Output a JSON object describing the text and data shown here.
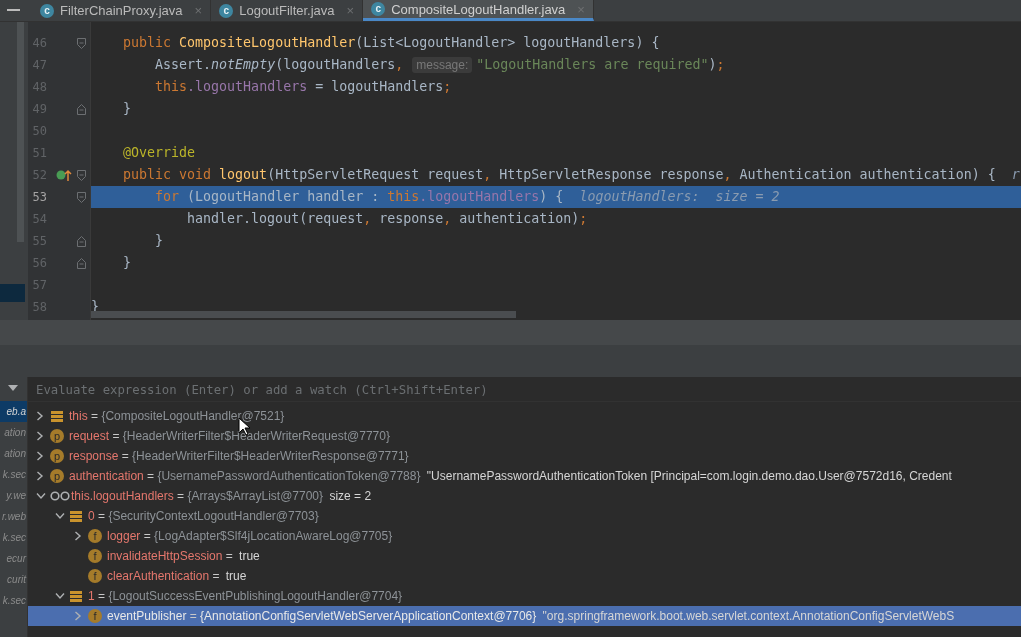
{
  "tabs": [
    {
      "label": "FilterChainProxy.java",
      "icon_letter": "c",
      "close": "×",
      "selected": false
    },
    {
      "label": "LogoutFilter.java",
      "icon_letter": "c",
      "close": "×",
      "selected": false
    },
    {
      "label": "CompositeLogoutHandler.java",
      "icon_letter": "c",
      "close": "×",
      "selected": true
    }
  ],
  "editor": {
    "lines": [
      {
        "number": "46",
        "fold_start": true,
        "fold_end": false,
        "override_marker": false,
        "current": false,
        "tokens": [
          {
            "kind": "keyword",
            "text": "    public "
          },
          {
            "kind": "function",
            "text": "CompositeLogoutHandler"
          },
          {
            "kind": "plain",
            "text": "(List<LogoutHandler> logoutHandlers) {"
          }
        ]
      },
      {
        "number": "47",
        "fold_start": false,
        "fold_end": false,
        "override_marker": false,
        "current": false,
        "tokens": [
          {
            "kind": "plain",
            "text": "        Assert."
          },
          {
            "kind": "static",
            "text": "notEmpty"
          },
          {
            "kind": "plain",
            "text": "(logoutHandlers"
          },
          {
            "kind": "keyword",
            "text": ","
          },
          {
            "kind": "hint",
            "text": "message:"
          },
          {
            "kind": "string",
            "text": "\"LogoutHandlers are required\""
          },
          {
            "kind": "plain",
            "text": ")"
          },
          {
            "kind": "keyword",
            "text": ";"
          }
        ]
      },
      {
        "number": "48",
        "fold_start": false,
        "fold_end": false,
        "override_marker": false,
        "current": false,
        "tokens": [
          {
            "kind": "keyword",
            "text": "        this"
          },
          {
            "kind": "field",
            "text": ".logoutHandlers"
          },
          {
            "kind": "plain",
            "text": " = logoutHandlers"
          },
          {
            "kind": "keyword",
            "text": ";"
          }
        ]
      },
      {
        "number": "49",
        "fold_start": false,
        "fold_end": true,
        "override_marker": false,
        "current": false,
        "tokens": [
          {
            "kind": "plain",
            "text": "    }"
          }
        ]
      },
      {
        "number": "50",
        "fold_start": false,
        "fold_end": false,
        "override_marker": false,
        "current": false
      },
      {
        "number": "51",
        "fold_start": false,
        "fold_end": false,
        "override_marker": false,
        "current": false,
        "tokens": [
          {
            "kind": "annotation",
            "text": "    @Override"
          }
        ]
      },
      {
        "number": "52",
        "fold_start": true,
        "fold_end": false,
        "override_marker": true,
        "current": false,
        "tokens": [
          {
            "kind": "keyword",
            "text": "    public void "
          },
          {
            "kind": "function",
            "text": "logout"
          },
          {
            "kind": "plain",
            "text": "(HttpServletRequest request"
          },
          {
            "kind": "keyword",
            "text": ", "
          },
          {
            "kind": "plain",
            "text": "HttpServletResponse response"
          },
          {
            "kind": "keyword",
            "text": ", "
          },
          {
            "kind": "plain",
            "text": "Authentication authentication) {"
          },
          {
            "kind": "inline",
            "text": "r"
          }
        ]
      },
      {
        "number": "53",
        "fold_start": true,
        "fold_end": false,
        "override_marker": false,
        "current": true,
        "tokens": [
          {
            "kind": "keyword",
            "text": "        for "
          },
          {
            "kind": "plain",
            "text": "(LogoutHandler handler : "
          },
          {
            "kind": "keyword",
            "text": "this"
          },
          {
            "kind": "field",
            "text": ".logoutHandlers"
          },
          {
            "kind": "plain",
            "text": ") {"
          },
          {
            "kind": "inline",
            "text": "logoutHandlers:  size = 2"
          }
        ]
      },
      {
        "number": "54",
        "fold_start": false,
        "fold_end": false,
        "override_marker": false,
        "current": false,
        "tokens": [
          {
            "kind": "plain",
            "text": "            handler.logout(request"
          },
          {
            "kind": "keyword",
            "text": ", "
          },
          {
            "kind": "plain",
            "text": "response"
          },
          {
            "kind": "keyword",
            "text": ", "
          },
          {
            "kind": "plain",
            "text": "authentication)"
          },
          {
            "kind": "keyword",
            "text": ";"
          }
        ]
      },
      {
        "number": "55",
        "fold_start": false,
        "fold_end": true,
        "override_marker": false,
        "current": false,
        "tokens": [
          {
            "kind": "plain",
            "text": "        }"
          }
        ]
      },
      {
        "number": "56",
        "fold_start": false,
        "fold_end": true,
        "override_marker": false,
        "current": false,
        "tokens": [
          {
            "kind": "plain",
            "text": "    }"
          }
        ]
      },
      {
        "number": "57",
        "fold_start": false,
        "fold_end": false,
        "override_marker": false,
        "current": false
      },
      {
        "number": "58",
        "fold_start": false,
        "fold_end": false,
        "override_marker": false,
        "current": false,
        "tokens": [
          {
            "kind": "plain",
            "text": "}"
          }
        ]
      }
    ]
  },
  "debugger": {
    "evaluate": {
      "placeholder": "Evaluate expression (Enter) or add a watch (Ctrl+Shift+Enter)"
    },
    "frames": [
      {
        "text": "eb.a",
        "selected": true
      },
      {
        "text": "ation",
        "selected": false
      },
      {
        "text": "ation",
        "selected": false
      },
      {
        "text": "k.sec",
        "selected": false
      },
      {
        "text": "y.we",
        "selected": false
      },
      {
        "text": "r.web",
        "selected": false
      },
      {
        "text": "k.sec",
        "selected": false
      },
      {
        "text": "ecur",
        "selected": false
      },
      {
        "text": "curit",
        "selected": false
      },
      {
        "text": "k.sec",
        "selected": false
      }
    ],
    "variables": [
      {
        "kind": "stack",
        "expandable": true,
        "expanded": false,
        "name": "this",
        "op": "=",
        "value": "{CompositeLogoutHandler@7521}",
        "selected": false
      },
      {
        "kind": "member",
        "letter": "p",
        "expandable": true,
        "expanded": false,
        "name": "request",
        "op": "=",
        "value": "{HeaderWriterFilter$HeaderWriterRequest@7770}",
        "selected": false
      },
      {
        "kind": "member",
        "letter": "p",
        "expandable": true,
        "expanded": false,
        "name": "response",
        "op": "=",
        "value": "{HeaderWriterFilter$HeaderWriterResponse@7771}",
        "selected": false
      },
      {
        "kind": "member",
        "letter": "p",
        "expandable": true,
        "expanded": false,
        "name": "authentication",
        "op": "=",
        "value": "{UsernamePasswordAuthenticationToken@7788}",
        "extra": "\"UsernamePasswordAuthenticationToken [Principal=com.login.demo.dao.User@7572d16, Credent",
        "selected": false
      },
      {
        "kind": "watch",
        "expandable": true,
        "expanded": true,
        "name": "this.logoutHandlers",
        "op": "=",
        "value": "{Arrays$ArrayList@7700}",
        "extra": "size = 2",
        "selected": false,
        "children": [
          {
            "kind": "stack",
            "expandable": true,
            "expanded": true,
            "name": "0",
            "op": "=",
            "value": "{SecurityContextLogoutHandler@7703}",
            "selected": false,
            "children": [
              {
                "kind": "member",
                "letter": "f",
                "expandable": true,
                "expanded": false,
                "name": "logger",
                "op": "=",
                "value": "{LogAdapter$Slf4jLocationAwareLog@7705}",
                "selected": false
              },
              {
                "kind": "member",
                "letter": "f",
                "expandable": false,
                "name": "invalidateHttpSession",
                "op": "=",
                "extra": "true",
                "selected": false
              },
              {
                "kind": "member",
                "letter": "f",
                "expandable": false,
                "name": "clearAuthentication",
                "op": "=",
                "extra": "true",
                "selected": false
              }
            ]
          },
          {
            "kind": "stack",
            "expandable": true,
            "expanded": true,
            "name": "1",
            "op": "=",
            "value": "{LogoutSuccessEventPublishingLogoutHandler@7704}",
            "selected": false,
            "children": [
              {
                "kind": "member",
                "letter": "f",
                "expandable": true,
                "expanded": false,
                "name": "eventPublisher",
                "op": "=",
                "value": "{AnnotationConfigServletWebServerApplicationContext@7706}",
                "extra": "\"org.springframework.boot.web.servlet.context.AnnotationConfigServletWebS",
                "selected": true
              }
            ]
          }
        ]
      }
    ]
  }
}
